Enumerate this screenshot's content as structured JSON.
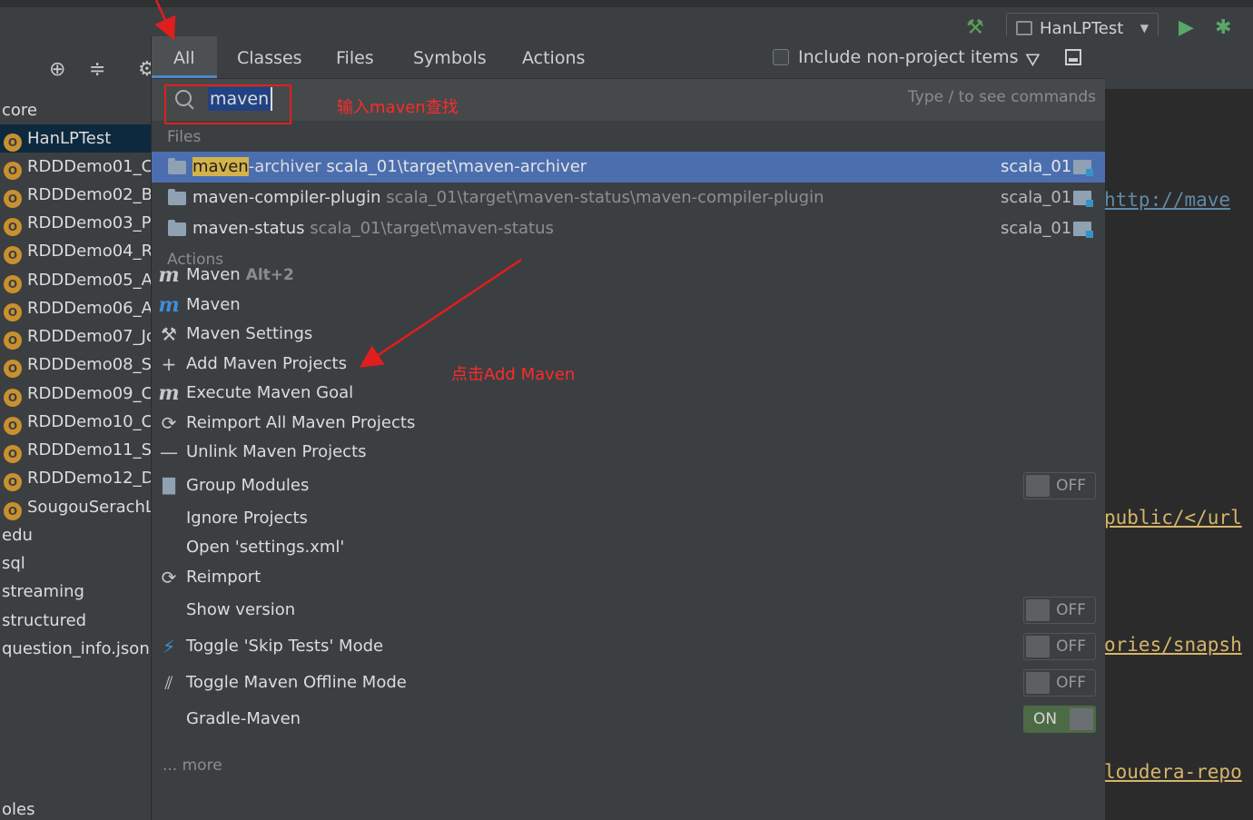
{
  "toolbar": {
    "run_config": "HanLPTest"
  },
  "project_tree": {
    "items": [
      {
        "label": "core",
        "type": "plain"
      },
      {
        "label": "HanLPTest",
        "type": "object",
        "selected": true
      },
      {
        "label": "RDDDemo01_C",
        "type": "object"
      },
      {
        "label": "RDDDemo02_B",
        "type": "object"
      },
      {
        "label": "RDDDemo03_P",
        "type": "object"
      },
      {
        "label": "RDDDemo04_R",
        "type": "object"
      },
      {
        "label": "RDDDemo05_A",
        "type": "object"
      },
      {
        "label": "RDDDemo06_A",
        "type": "object"
      },
      {
        "label": "RDDDemo07_Jo",
        "type": "object"
      },
      {
        "label": "RDDDemo08_S",
        "type": "object"
      },
      {
        "label": "RDDDemo09_C",
        "type": "object"
      },
      {
        "label": "RDDDemo10_C",
        "type": "object"
      },
      {
        "label": "RDDDemo11_Sl",
        "type": "object"
      },
      {
        "label": "RDDDemo12_D",
        "type": "object"
      },
      {
        "label": "SougouSerachL",
        "type": "object"
      },
      {
        "label": "edu",
        "type": "plain"
      },
      {
        "label": "sql",
        "type": "plain"
      },
      {
        "label": "streaming",
        "type": "plain"
      },
      {
        "label": "structured",
        "type": "plain"
      },
      {
        "label": "question_info.json",
        "type": "plain"
      },
      {
        "label": "oles",
        "type": "plain"
      }
    ]
  },
  "editor_lines": [
    "http://mave",
    "public/</url",
    "ories/snapsh",
    "loudera-repo"
  ],
  "popup": {
    "tabs": [
      "All",
      "Classes",
      "Files",
      "Symbols",
      "Actions"
    ],
    "include_label": "Include non-project items",
    "search_value": "maven",
    "hint": "Type / to see commands",
    "annotation_search": "输入maven查找",
    "annotation_add": "点击Add Maven",
    "files_header": "Files",
    "files": [
      {
        "match": "maven",
        "rest": "-archiver",
        "path": "scala_01\\target\\maven-archiver",
        "module": "scala_01"
      },
      {
        "name": "maven-compiler-plugin",
        "path": "scala_01\\target\\maven-status\\maven-compiler-plugin",
        "module": "scala_01"
      },
      {
        "name": "maven-status",
        "path": "scala_01\\target\\maven-status",
        "module": "scala_01"
      }
    ],
    "actions_header": "Actions",
    "actions": [
      {
        "label": "Maven",
        "shortcut": "Alt+2",
        "icon": "m-icon"
      },
      {
        "label": "Maven",
        "icon": "m-blue-icon"
      },
      {
        "label": "Maven Settings",
        "icon": "wrench-icon"
      },
      {
        "label": "Add Maven Projects",
        "icon": "plus-icon"
      },
      {
        "label": "Execute Maven Goal",
        "icon": "m-icon"
      },
      {
        "label": "Reimport All Maven Projects",
        "icon": "refresh-icon"
      },
      {
        "label": "Unlink Maven Projects",
        "icon": "minus-icon"
      },
      {
        "label": "Group Modules",
        "icon": "folder-icon",
        "toggle": "OFF"
      },
      {
        "label": "Ignore Projects"
      },
      {
        "label": "Open 'settings.xml'"
      },
      {
        "label": "Reimport",
        "icon": "refresh-icon"
      },
      {
        "label": "Show version",
        "toggle": "OFF"
      },
      {
        "label": "Toggle 'Skip Tests' Mode",
        "icon": "bolt-icon",
        "toggle": "OFF"
      },
      {
        "label": "Toggle Maven Offline Mode",
        "icon": "offline-icon",
        "toggle": "OFF"
      },
      {
        "label": "Gradle-Maven",
        "toggle": "ON"
      }
    ],
    "more": "... more"
  }
}
